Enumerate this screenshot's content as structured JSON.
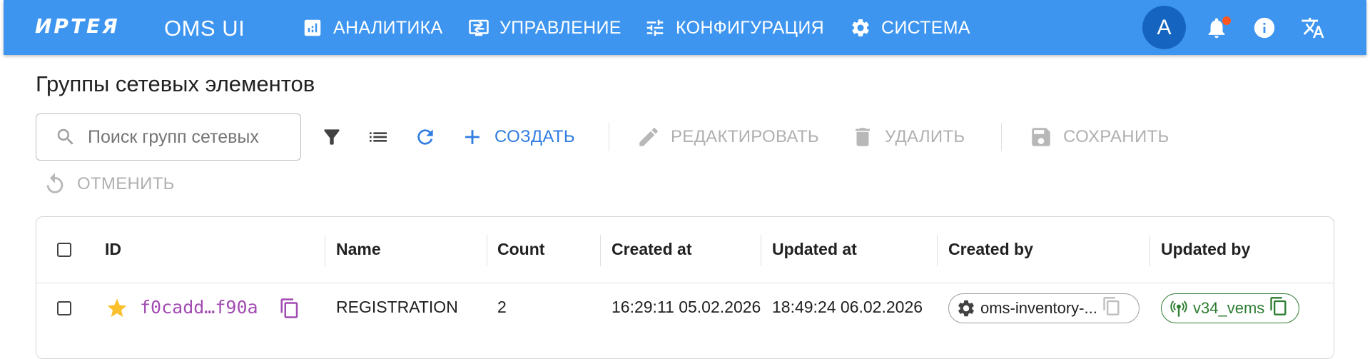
{
  "appbar": {
    "brand": "ИРТЕЯ",
    "product": "OMS UI",
    "nav": [
      {
        "label": "АНАЛИТИКА",
        "icon": "analytics-icon"
      },
      {
        "label": "УПРАВЛЕНИЕ",
        "icon": "management-icon"
      },
      {
        "label": "КОНФИГУРАЦИЯ",
        "icon": "tune-icon"
      },
      {
        "label": "СИСТЕМА",
        "icon": "gear-icon"
      }
    ],
    "avatar_letter": "A",
    "icons": [
      "bell-icon",
      "info-icon",
      "translate-icon"
    ],
    "color": "#3d95f0"
  },
  "page": {
    "title": "Группы сетевых элементов"
  },
  "toolbar": {
    "search_placeholder": "Поиск групп сетевых элементов",
    "create_label": "СОЗДАТЬ",
    "edit_label": "РЕДАКТИРОВАТЬ",
    "delete_label": "УДАЛИТЬ",
    "save_label": "СОХРАНИТЬ",
    "cancel_label": "ОТМЕНИТЬ"
  },
  "table": {
    "columns": [
      "ID",
      "Name",
      "Count",
      "Created at",
      "Updated at",
      "Created by",
      "Updated by"
    ],
    "rows": [
      {
        "id": "f0cadd…f90a",
        "name": "REGISTRATION",
        "count": "2",
        "created_at": "16:29:11 05.02.2026",
        "updated_at": "18:49:24 06.02.2026",
        "created_by": "oms-inventory-...",
        "updated_by": "v34_vems"
      }
    ]
  },
  "colors": {
    "accent": "#2f7de1",
    "id_text": "#a24bb2",
    "star": "#fbc02d",
    "green": "#2e7d32",
    "notification_dot": "#ff5722"
  }
}
